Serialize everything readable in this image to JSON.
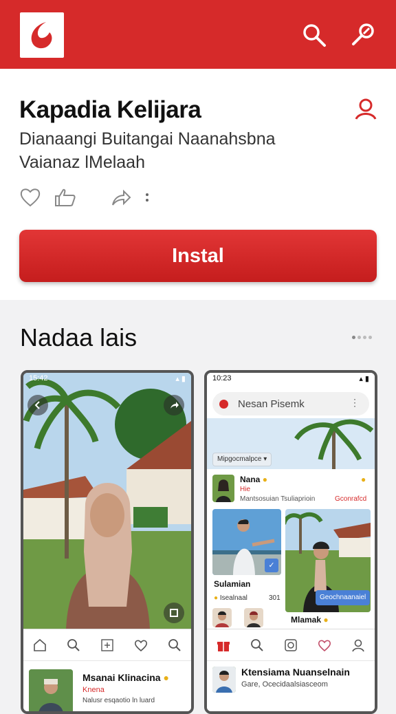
{
  "topbar": {
    "color": "#d62a2a",
    "icons": [
      "app-logo-icon",
      "search-icon",
      "edit-icon"
    ]
  },
  "app": {
    "title": "Kapadia Kelijara",
    "subtitle_line1": "Dianaangi Buitangai Naanahsbna",
    "subtitle_line2": "Vaianaz lMelaah",
    "install_label": "Instal",
    "action_icons": [
      "heart-icon",
      "thumbs-up-icon",
      "share-icon",
      "more-icon"
    ]
  },
  "section": {
    "title": "Nadaa lais"
  },
  "screenshot1": {
    "time": "15:42",
    "nav_icons": [
      "home-icon",
      "search-icon",
      "add-icon",
      "heart-icon",
      "search-icon"
    ],
    "feed": {
      "name": "Msanai Klinacina",
      "tag": "Knena",
      "desc": "Nalusr esqaotio ln luard"
    }
  },
  "screenshot2": {
    "time": "10:23",
    "search_text": "Nesan Pisemk",
    "chip": "Mipgocmalpce",
    "profile": {
      "name": "Nana",
      "tag": "Hie",
      "desc": "Mantsosuian Tsuliaprioin",
      "link": "Gconrafcd"
    },
    "tile1_label": "Sulamian",
    "tile1_sub": "Isealnaal",
    "tile1_count": "301",
    "tile2_button": "Geochnaanaiel",
    "tile2_label": "Mlamak",
    "nav_icons": [
      "gift-icon",
      "search-icon",
      "camera-icon",
      "heart-icon",
      "user-icon"
    ],
    "feed": {
      "name": "Ktensiama Nuanselnain",
      "desc": "Gare, Ocecidaalsiasceom"
    }
  }
}
